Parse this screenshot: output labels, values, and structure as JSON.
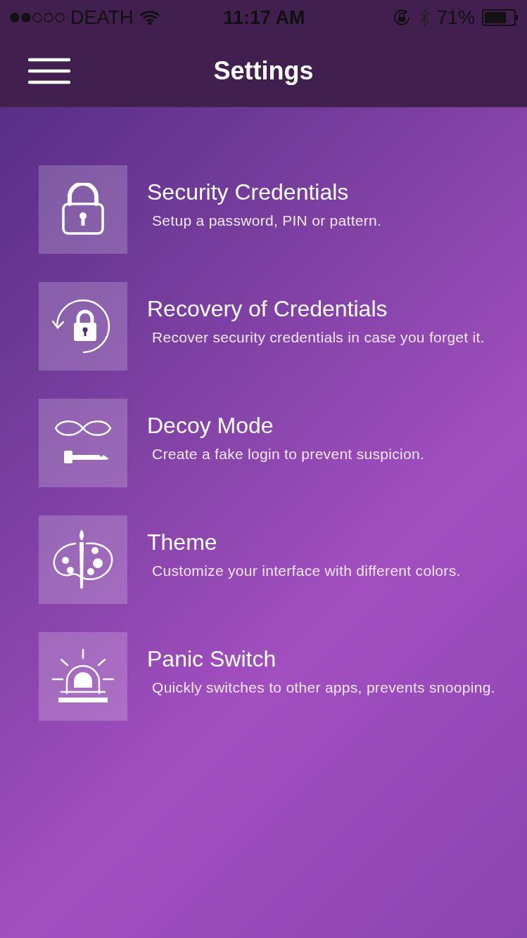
{
  "status_bar": {
    "carrier": "DEATH",
    "time": "11:17 AM",
    "battery": "71%"
  },
  "nav_bar": {
    "title": "Settings"
  },
  "items": [
    {
      "kind": "lock",
      "title": "Security Credentials",
      "subtitle": "Setup a password, PIN or pattern."
    },
    {
      "kind": "recovery",
      "title": "Recovery of Credentials",
      "subtitle": "Recover security credentials in case you forget it."
    },
    {
      "kind": "decoy",
      "title": "Decoy Mode",
      "subtitle": "Create a fake login to prevent suspicion."
    },
    {
      "kind": "theme",
      "title": "Theme",
      "subtitle": "Customize your interface with different colors."
    },
    {
      "kind": "panic",
      "title": "Panic Switch",
      "subtitle": "Quickly switches to other apps, prevents snooping."
    }
  ]
}
